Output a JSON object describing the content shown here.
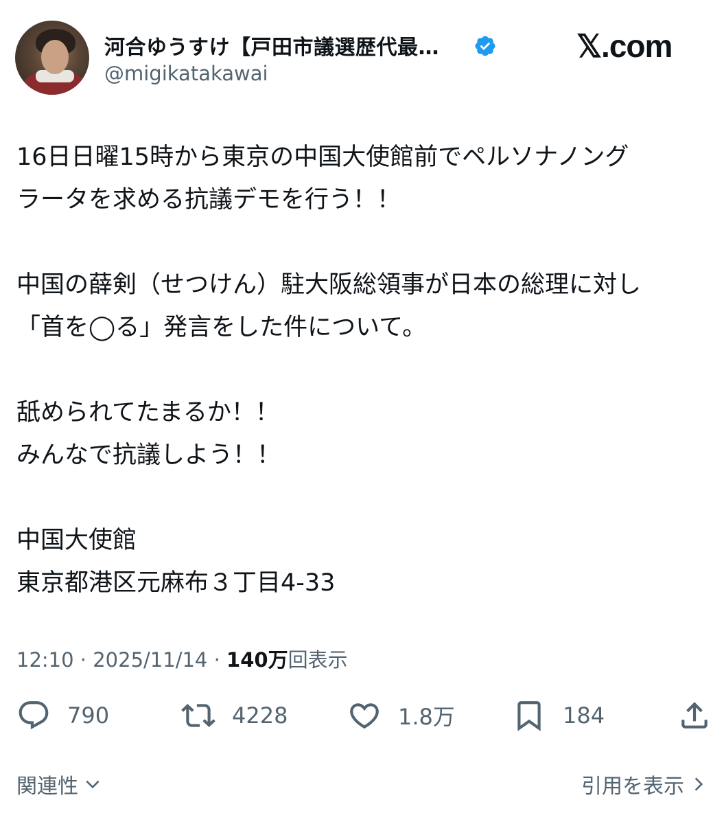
{
  "author": {
    "display_name": "河合ゆうすけ【戸田市議選歴代最…",
    "handle": "@migikatakawai",
    "verified_color": "#1d9bf0"
  },
  "brand": {
    "label": "𝕏.com"
  },
  "tweet": {
    "text": "16日日曜15時から東京の中国大使館前でペルソナノング\nラータを求める抗議デモを行う！！\n\n中国の薛剣（せつけん）駐大阪総領事が日本の総理に対し\n「首を◯る」発言をした件について。\n\n舐められてたまるか！！\nみんなで抗議しよう！！\n\n中国大使館\n東京都港区元麻布３丁目4-33"
  },
  "meta": {
    "time": "12:10",
    "separator": "·",
    "date": "2025/11/14",
    "views_count": "140万",
    "views_label": "回表示"
  },
  "actions": {
    "replies": {
      "icon": "reply-icon",
      "count": "790"
    },
    "reposts": {
      "icon": "repost-icon",
      "count": "4228"
    },
    "likes": {
      "icon": "heart-icon",
      "count": "1.8万"
    },
    "bookmarks": {
      "icon": "bookmark-icon",
      "count": "184"
    },
    "share": {
      "icon": "share-icon"
    }
  },
  "footer": {
    "related_label": "関連性",
    "quotes_label": "引用を表示"
  },
  "colors": {
    "text": "#0f1419",
    "secondary": "#536471",
    "accent": "#1d9bf0"
  }
}
